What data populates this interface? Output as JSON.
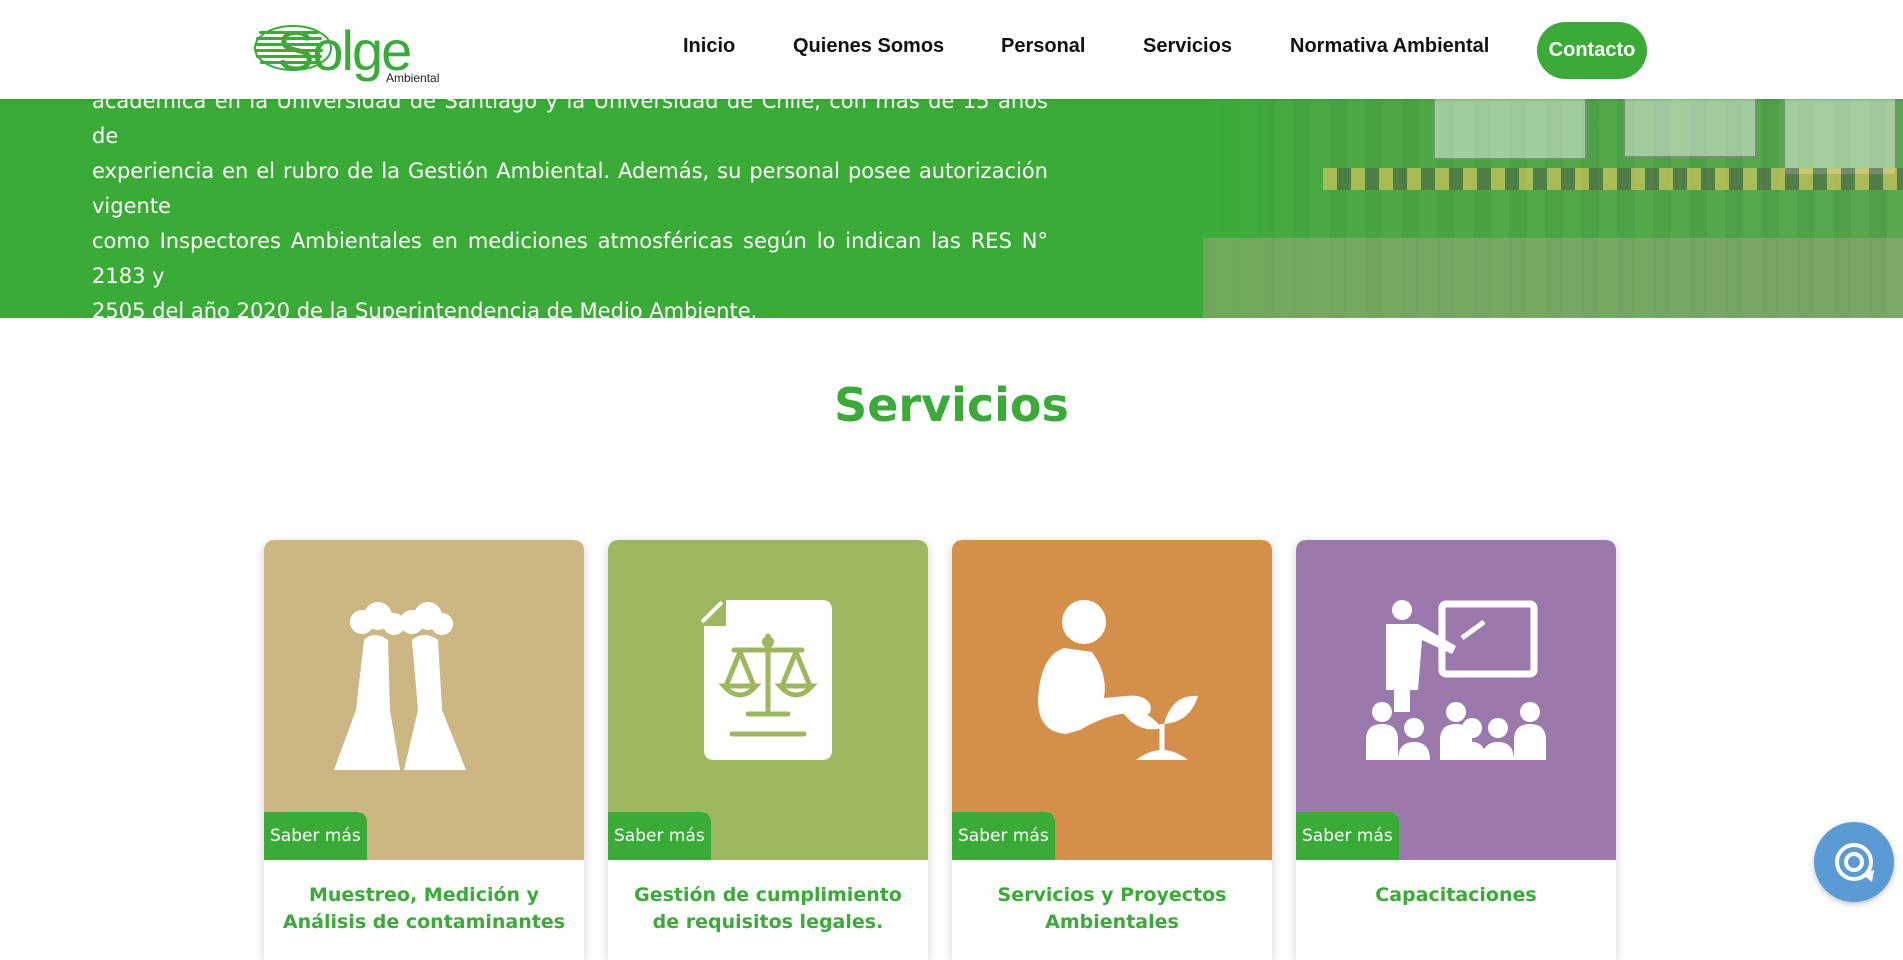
{
  "header": {
    "logo_text": "Solge",
    "logo_sub": "Ambiental",
    "nav": [
      "Inicio",
      "Quienes Somos",
      "Personal",
      "Servicios",
      "Normativa Ambiental"
    ],
    "contact_label": "Contacto"
  },
  "hero": {
    "lines": [
      "académica en la Universidad de Santiago y la Universidad de Chile, con más de 15 años de",
      "experiencia en el rubro de la Gestión Ambiental. Además, su personal posee autorización vigente",
      "como Inspectores Ambientales en mediciones atmosféricas según lo indican las RES N° 2183 y",
      "2505 del año 2020 de la Superintendencia de Medio Ambiente."
    ]
  },
  "services": {
    "title": "Servicios",
    "cards": [
      {
        "title": "Muestreo, Medición y Análisis de contaminantes",
        "button": "Saber más",
        "color": "#ccb784",
        "icon": "factory-icon"
      },
      {
        "title": "Gestión de cumplimiento de requisitos legales.",
        "button": "Saber más",
        "color": "#9cb75e",
        "icon": "legal-document-icon"
      },
      {
        "title": "Servicios y Proyectos Ambientales",
        "button": "Saber más",
        "color": "#d48f4b",
        "icon": "planting-icon"
      },
      {
        "title": "Capacitaciones",
        "button": "Saber más",
        "color": "#9b79ad",
        "icon": "training-icon"
      }
    ]
  },
  "colors": {
    "accent": "#3aab36",
    "chat": "#5b9bd5"
  }
}
